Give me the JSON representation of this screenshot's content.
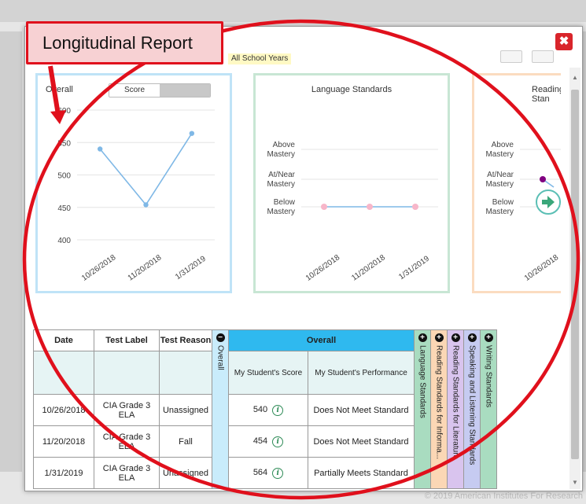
{
  "modal": {
    "years_filter": "All School Years",
    "close_symbol": "✖"
  },
  "callout": {
    "label": "Longitudinal Report"
  },
  "footer": "© 2019 American Institutes For Research",
  "panels": {
    "overall": {
      "title": "Overall",
      "toggle_label": "Score",
      "chart_data": {
        "type": "line",
        "x": [
          "10/26/2018",
          "11/20/2018",
          "1/31/2019"
        ],
        "values": [
          540,
          454,
          564
        ],
        "ylim": [
          400,
          600
        ],
        "yticks": [
          400,
          450,
          500,
          550,
          600
        ],
        "color": "#7fb8e6"
      }
    },
    "language": {
      "title": "Language Standards",
      "y_categories": [
        "Above Mastery",
        "At/Near Mastery",
        "Below Mastery"
      ],
      "chart_data": {
        "type": "line",
        "x": [
          "10/26/2018",
          "11/20/2018",
          "1/31/2019"
        ],
        "values": [
          "Below Mastery",
          "Below Mastery",
          "Below Mastery"
        ],
        "color": "#7fb8e6",
        "marker_color": "#f7b6c9"
      }
    },
    "reading": {
      "title": "Reading Stan",
      "y_categories": [
        "Above Mastery",
        "At/Near Mastery",
        "Below Mastery"
      ],
      "chart_data": {
        "type": "line",
        "x": [
          "10/26/2018"
        ],
        "values": [
          "At/Near Mastery"
        ],
        "marker_color": "#800080"
      }
    }
  },
  "table": {
    "headers": {
      "date": "Date",
      "label": "Test Label",
      "reason": "Test Reason",
      "overall_vert": "Overall",
      "overall": "Overall",
      "score": "My Student's Score",
      "performance": "My Student's Performance"
    },
    "rows": [
      {
        "date": "10/26/2018",
        "label": "CIA Grade 3 ELA",
        "reason": "Unassigned",
        "score": "540",
        "performance": "Does Not Meet Standard"
      },
      {
        "date": "11/20/2018",
        "label": "CIA Grade 3 ELA",
        "reason": "Fall",
        "score": "454",
        "performance": "Does Not Meet Standard"
      },
      {
        "date": "1/31/2019",
        "label": "CIA Grade 3 ELA",
        "reason": "Unassigned",
        "score": "564",
        "performance": "Partially Meets Standard"
      }
    ],
    "claims": [
      {
        "label": "Language Standards",
        "color": "#a9dcc0"
      },
      {
        "label": "Reading Standards for Informa...",
        "color": "#fbd7b5"
      },
      {
        "label": "Reading Standards for Literature",
        "color": "#d9c4ee"
      },
      {
        "label": "Speaking and Listening Standards",
        "color": "#c6cbf1"
      },
      {
        "label": "Writing Standards",
        "color": "#a9dcc0"
      }
    ]
  }
}
